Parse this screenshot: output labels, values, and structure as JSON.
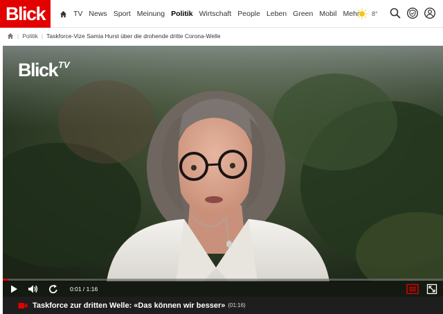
{
  "header": {
    "logo": "Blick",
    "nav": [
      "TV",
      "News",
      "Sport",
      "Meinung",
      "Politik",
      "Wirtschaft",
      "People",
      "Leben",
      "Green",
      "Mobil",
      "Mehr"
    ],
    "active_nav": "Politik",
    "weather": {
      "temp": "8°",
      "icon": "sun-icon"
    }
  },
  "breadcrumb": {
    "section": "Politik",
    "title": "Taskforce-Vize Samia Hurst über die drohende dritte Corona-Welle"
  },
  "video": {
    "brand": "Blick",
    "brand_suffix": "TV",
    "time": "0:01 / 1:16",
    "progress": 0.013,
    "caption_title": "Taskforce zur dritten Welle: «Das können wir besser»",
    "caption_duration": "(01:16)"
  },
  "colors": {
    "brand_red": "#e20000",
    "caption_bg": "#1e1e1e"
  }
}
